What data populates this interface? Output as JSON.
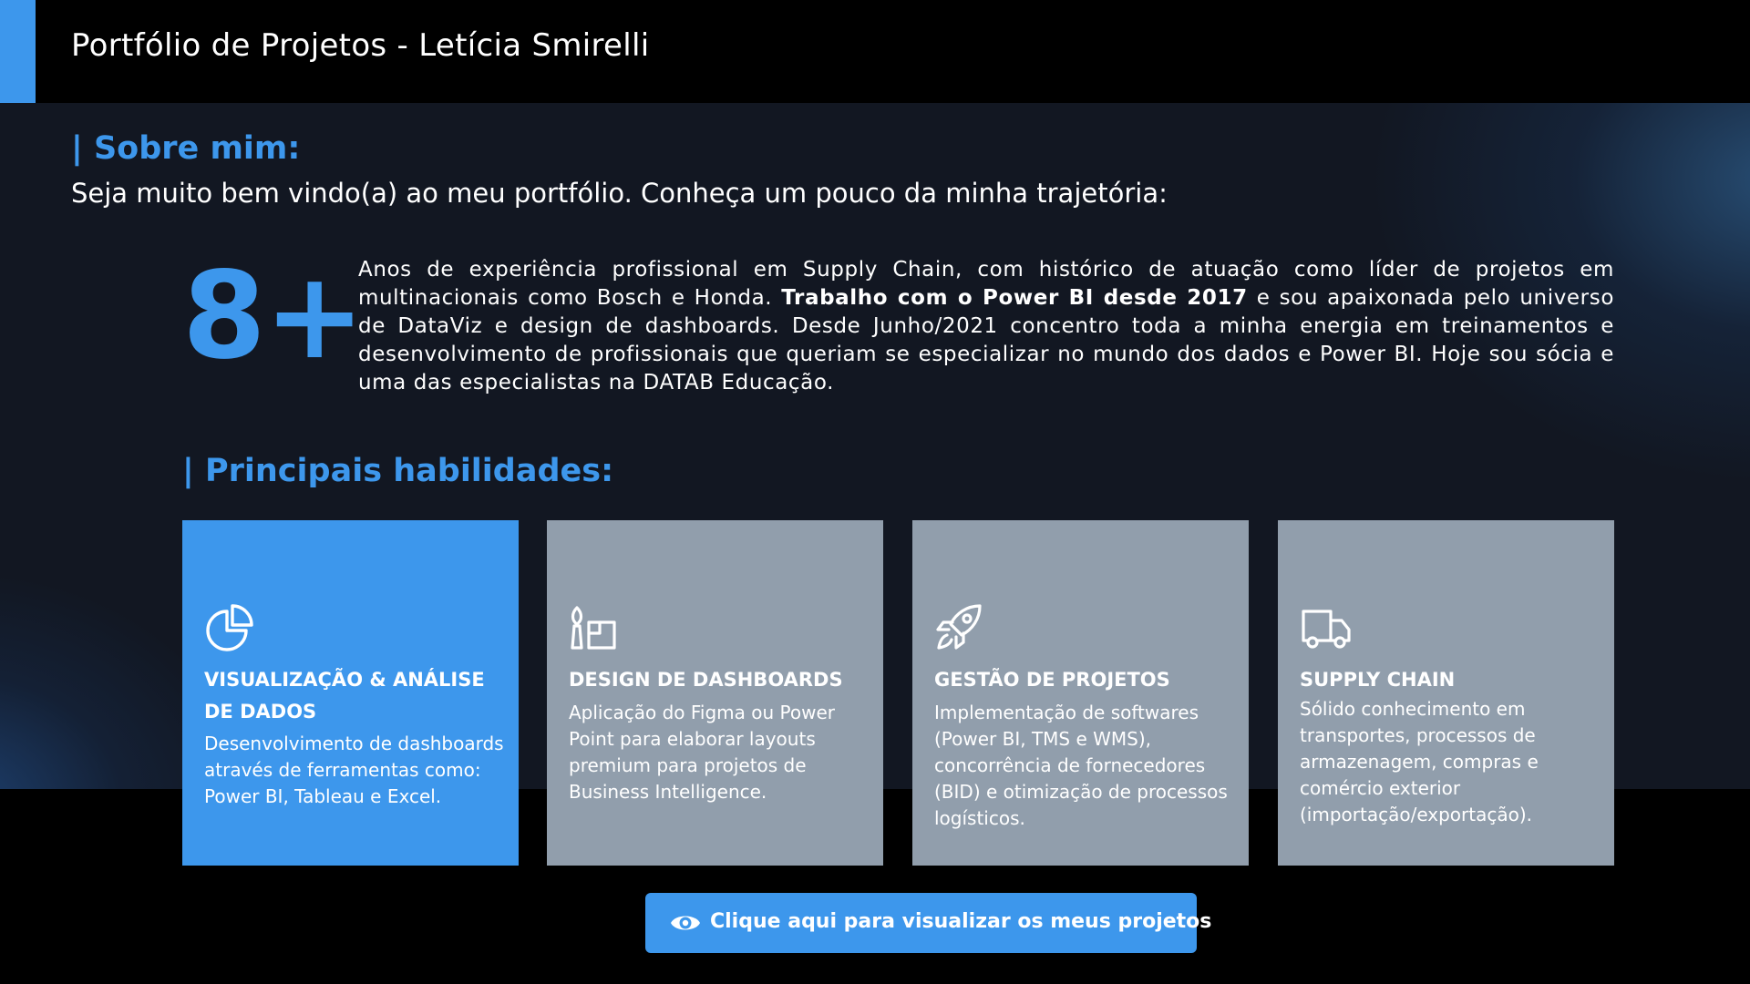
{
  "header": {
    "title": "Portfólio de Projetos - Letícia Smirelli"
  },
  "about": {
    "section_title": "| Sobre mim:",
    "welcome": "Seja muito bem vindo(a) ao meu portfólio. Conheça um pouco da minha trajetória:",
    "years_stat": "8+",
    "text_part1": "Anos de experiência profissional em Supply Chain, com histórico de atuação como líder de projetos em multinacionais como Bosch e Honda. ",
    "text_bold": "Trabalho com o Power BI desde 2017",
    "text_part2": " e sou apaixonada pelo universo de DataViz e design de dashboards. Desde Junho/2021 concentro toda a minha energia em treinamentos e desenvolvimento de profissionais que queriam se especializar no mundo dos dados e Power BI. Hoje sou sócia e uma das especialistas na DATAB Educação."
  },
  "skills": {
    "section_title": "| Principais habilidades:",
    "items": [
      {
        "icon": "pie-chart-icon",
        "title": "VISUALIZAÇÃO & ANÁLISE DE DADOS",
        "description": "Desenvolvimento de dashboards através de ferramentas como: Power BI, Tableau e Excel."
      },
      {
        "icon": "design-tools-icon",
        "title": "DESIGN DE DASHBOARDS",
        "description": "Aplicação do Figma ou Power Point para elaborar layouts premium para projetos de Business Intelligence."
      },
      {
        "icon": "rocket-icon",
        "title": "GESTÃO DE PROJETOS",
        "description": "Implementação de softwares (Power BI, TMS e WMS), concorrência de fornecedores (BID) e otimização de processos logísticos."
      },
      {
        "icon": "truck-icon",
        "title": "SUPPLY CHAIN",
        "description": "Sólido conhecimento em transportes, processos de armazenagem, compras e comércio exterior (importação/exportação)."
      }
    ]
  },
  "cta": {
    "icon": "eye-icon",
    "label": "Clique aqui para visualizar os meus projetos"
  },
  "colors": {
    "accent": "#3d97ec",
    "card_gray": "#919eac",
    "panel_bg": "#121722",
    "page_bg": "#000000"
  }
}
